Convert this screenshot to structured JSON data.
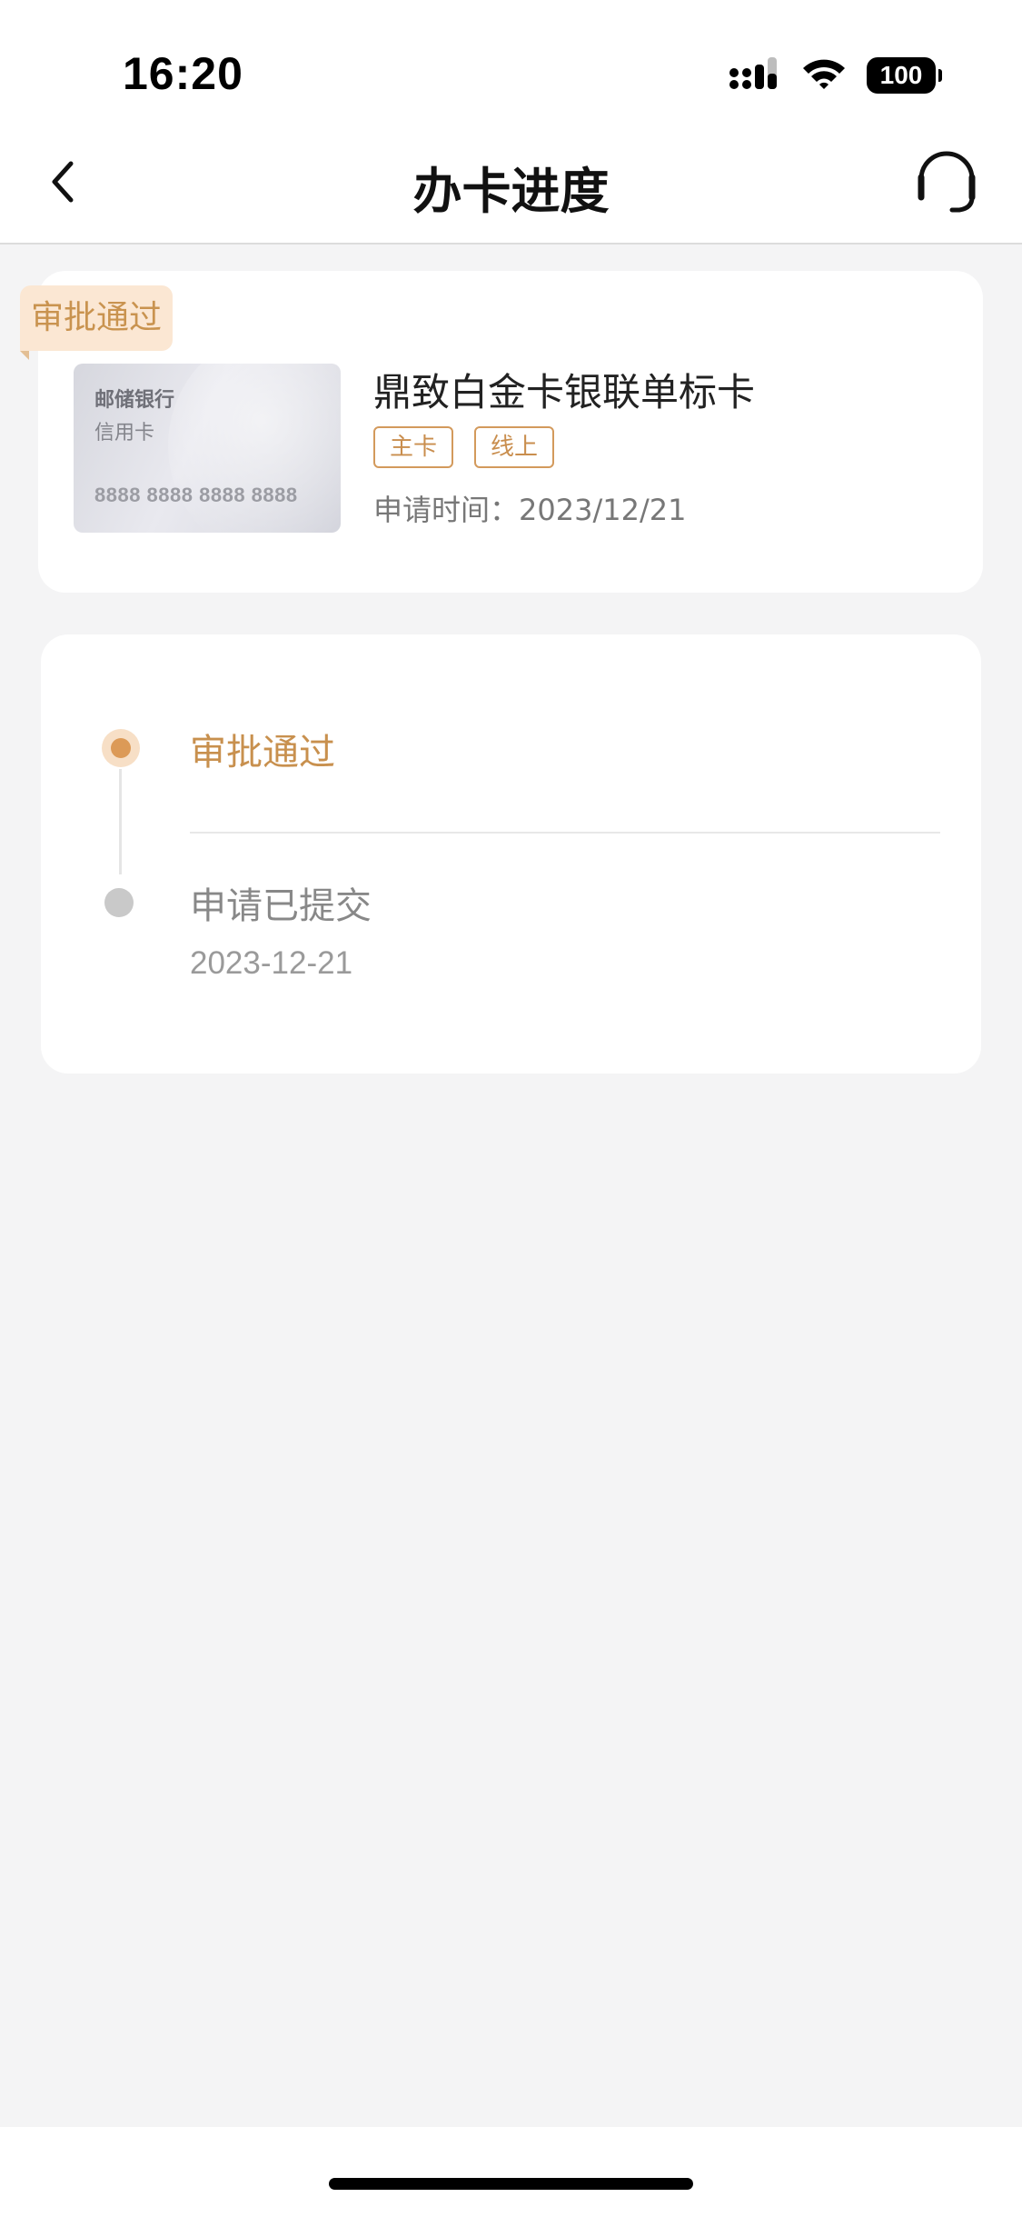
{
  "status_bar": {
    "time": "16:20",
    "battery": "100",
    "icons": [
      "signal-icon",
      "wifi-icon",
      "battery-icon"
    ]
  },
  "nav": {
    "title": "办卡进度",
    "back_icon": "chevron-left-icon",
    "service_icon": "headset-icon"
  },
  "card": {
    "status_ribbon": "审批通过",
    "image": {
      "bank": "邮储银行",
      "type": "信用卡",
      "number": "8888 8888 8888 8888"
    },
    "name": "鼎致白金卡银联单标卡",
    "tags": [
      "主卡",
      "线上"
    ],
    "apply_time": "申请时间：2023/12/21"
  },
  "progress": {
    "steps": [
      {
        "label": "审批通过",
        "date": "",
        "state": "active"
      },
      {
        "label": "申请已提交",
        "date": "2023-12-21",
        "state": "done"
      }
    ]
  },
  "colors": {
    "accent": "#c8904e",
    "accent_dot": "#dc9a57",
    "background": "#f4f4f5"
  }
}
